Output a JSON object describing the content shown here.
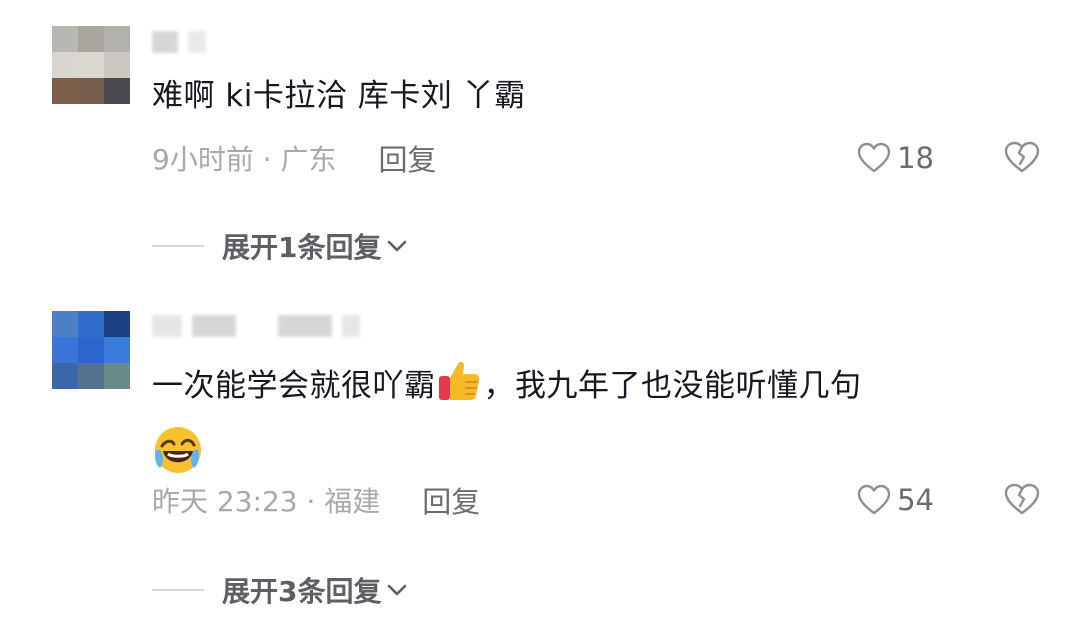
{
  "comments": [
    {
      "text": "难啊   ki卡拉洽 库卡刘 丫霸",
      "time": "9小时前 · 广东",
      "reply_label": "回复",
      "likes": "18",
      "expand_label": "展开1条回复"
    },
    {
      "text_part1": "一次能学会就很吖霸",
      "text_part2": "，我九年了也没能听懂几句",
      "time": "昨天 23:23 · 福建",
      "reply_label": "回复",
      "likes": "54",
      "expand_label": "展开3条回复"
    }
  ],
  "icons": {
    "heart": "heart-outline-icon",
    "dislike": "broken-heart-icon",
    "expand": "chevron-down-icon",
    "emoji1": "thumbs-up-emoji",
    "emoji2": "laughing-crying-emoji"
  },
  "colors": {
    "text": "#161823",
    "meta": "#a8a9ad",
    "reply": "#6b6c70"
  }
}
